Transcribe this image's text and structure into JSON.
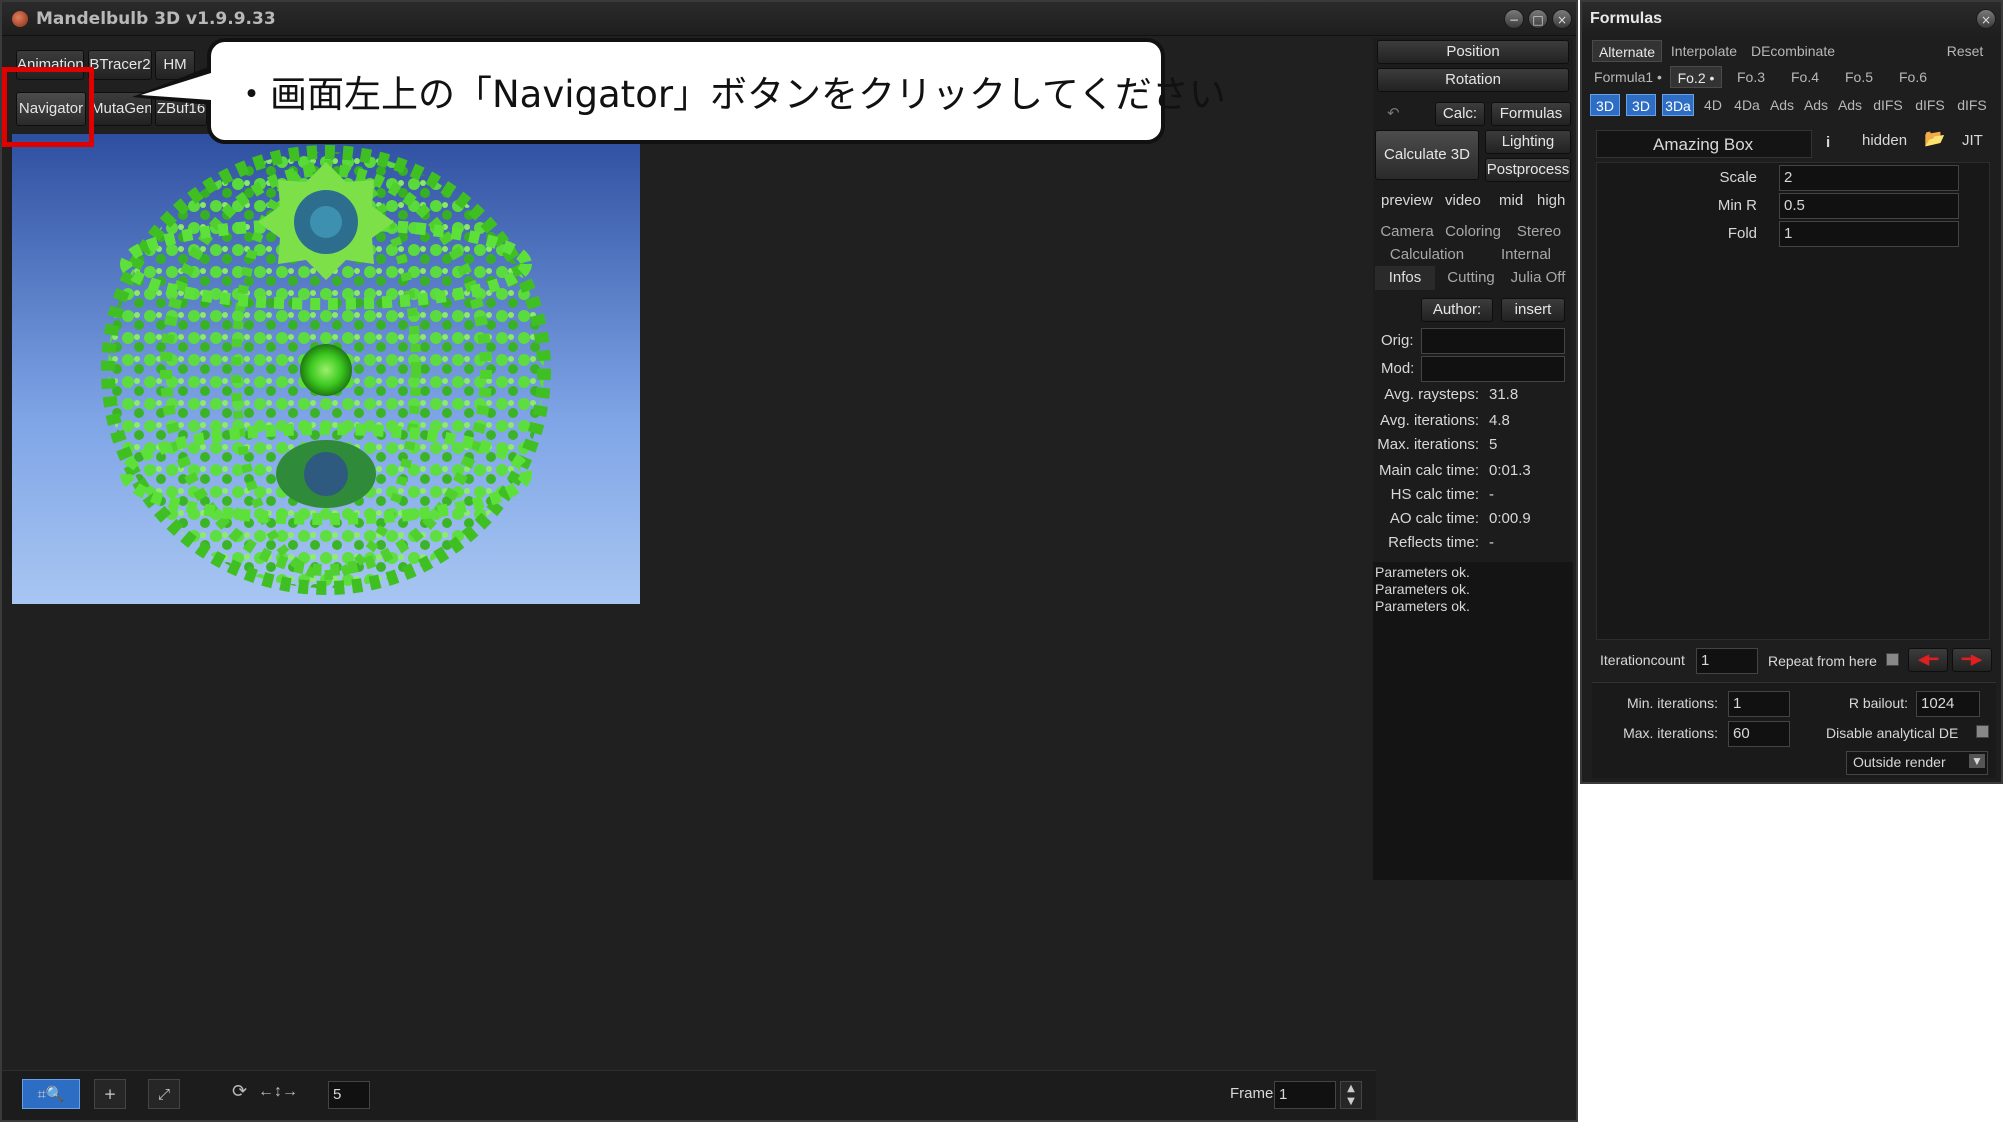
{
  "main_window": {
    "title": "Mandelbulb 3D   v1.9.9.33",
    "controls": [
      "−",
      "□",
      "×"
    ]
  },
  "top_buttons": {
    "animations": "Animations",
    "btracer2": "BTracer2",
    "hm": "HM",
    "navigator": "Navigator",
    "mutagen": "MutaGen",
    "zbuf16": "ZBuf16"
  },
  "callout": {
    "text": "・画面左上の「Navigator」ボタンをクリックしてください"
  },
  "control_panel": {
    "position": "Position",
    "rotation": "Rotation",
    "calc": "Calc:",
    "formulas": "Formulas",
    "calculate_3d": "Calculate 3D",
    "lighting": "Lighting",
    "postprocess": "Postprocess",
    "quality": [
      "preview",
      "video",
      "mid",
      "high"
    ],
    "tabs_row1": [
      "Camera",
      "Coloring",
      "Stereo"
    ],
    "tabs_row2": [
      "Calculation",
      "Internal"
    ],
    "tabs_row3": [
      "Infos",
      "Cutting",
      "Julia Off"
    ],
    "author": "Author:",
    "insert": "insert",
    "orig_label": "Orig:",
    "mod_label": "Mod:",
    "stats": [
      {
        "label": "Avg. raysteps:",
        "value": "31.8"
      },
      {
        "label": "Avg. iterations:",
        "value": "4.8"
      },
      {
        "label": "Max. iterations:",
        "value": "5"
      },
      {
        "label": "Main calc time:",
        "value": "0:01.3"
      },
      {
        "label": "HS calc time:",
        "value": "-"
      },
      {
        "label": "AO calc time:",
        "value": "0:00.9"
      },
      {
        "label": "Reflects time:",
        "value": "-"
      }
    ],
    "log": [
      "Parameters ok.",
      "Parameters ok.",
      "Parameters ok."
    ]
  },
  "bottom_bar": {
    "step_value": "5",
    "frame_label": "Frame:",
    "frame_value": "1"
  },
  "formulas_window": {
    "title": "Formulas",
    "top_tabs": [
      "Alternate",
      "Interpolate",
      "DEcombinate"
    ],
    "reset": "Reset",
    "formula_tabs": [
      "Formula1 •",
      "Fo.2 •",
      "Fo.3",
      "Fo.4",
      "Fo.5",
      "Fo.6"
    ],
    "type_tabs": [
      "3D",
      "3D",
      "3Da",
      "4D",
      "4Da",
      "Ads",
      "Ads",
      "Ads",
      "dIFS",
      "dIFS",
      "dIFS"
    ],
    "formula_name": "Amazing Box",
    "info": "i",
    "hidden": "hidden",
    "jit": "JIT",
    "params": [
      {
        "label": "Scale",
        "value": "2"
      },
      {
        "label": "Min R",
        "value": "0.5"
      },
      {
        "label": "Fold",
        "value": "1"
      }
    ],
    "iterationcount_label": "Iterationcount",
    "iterationcount_value": "1",
    "repeat_from_here": "Repeat from here",
    "min_iterations_label": "Min. iterations:",
    "min_iterations_value": "1",
    "max_iterations_label": "Max. iterations:",
    "max_iterations_value": "60",
    "r_bailout_label": "R bailout:",
    "r_bailout_value": "1024",
    "disable_de": "Disable analytical DE",
    "outside_render": "Outside render"
  },
  "colors": {
    "highlight": "#e00000",
    "accent_blue": "#2e6dc4",
    "fractal_green": "#4ee030"
  }
}
